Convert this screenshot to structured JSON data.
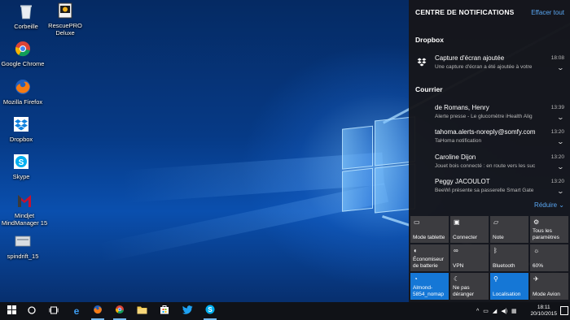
{
  "desktop": {
    "icons": [
      {
        "label": "Corbeille",
        "icon": "recycle-bin-icon"
      },
      {
        "label": "RescuePRO Deluxe",
        "icon": "rescuepro-icon"
      },
      {
        "label": "Google Chrome",
        "icon": "chrome-icon"
      },
      {
        "label": "Mozilla Firefox",
        "icon": "firefox-icon"
      },
      {
        "label": "Dropbox",
        "icon": "dropbox-icon"
      },
      {
        "label": "Skype",
        "icon": "skype-icon"
      },
      {
        "label": "Mindjet MindManager 15",
        "icon": "mindmanager-icon"
      },
      {
        "label": "spindrift_15",
        "icon": "file-icon"
      }
    ]
  },
  "action_center": {
    "title": "CENTRE DE NOTIFICATIONS",
    "clear_all": "Effacer tout",
    "groups": [
      {
        "name": "Dropbox",
        "notifications": [
          {
            "title": "Capture d'écran ajoutée",
            "body": "Une capture d'écran a été ajoutée à votre",
            "time": "18:08"
          }
        ]
      },
      {
        "name": "Courrier",
        "notifications": [
          {
            "title": "de Romans, Henry",
            "body": "Alerte presse - Le glucomètre iHealth Alig",
            "time": "13:39"
          },
          {
            "title": "tahoma.alerts-noreply@somfy.com",
            "body": "TaHoma notification",
            "time": "13:20"
          },
          {
            "title": "Caroline Dijon",
            "body": "Jouet bois connecté : en route vers les suc",
            "time": "13:20"
          },
          {
            "title": "Peggy JACOULOT",
            "body": "BeeWi présente sa passerelle Smart Gate",
            "time": "13:20"
          }
        ]
      }
    ],
    "collapse": "Réduire",
    "quick_actions": [
      {
        "label": "Mode tablette",
        "icon": "tablet-mode-icon",
        "on": false
      },
      {
        "label": "Connecter",
        "icon": "connect-icon",
        "on": false
      },
      {
        "label": "Note",
        "icon": "note-icon",
        "on": false
      },
      {
        "label": "Tous les paramètres",
        "icon": "settings-icon",
        "on": false
      },
      {
        "label": "Économiseur de batterie",
        "icon": "battery-saver-icon",
        "on": false
      },
      {
        "label": "VPN",
        "icon": "vpn-icon",
        "on": false
      },
      {
        "label": "Bluetooth",
        "icon": "bluetooth-icon",
        "on": false
      },
      {
        "label": "60%",
        "icon": "brightness-icon",
        "on": false
      },
      {
        "label": "Almond-5854_nomap",
        "icon": "wifi-icon",
        "on": true
      },
      {
        "label": "Ne pas déranger",
        "icon": "quiet-hours-icon",
        "on": false
      },
      {
        "label": "Localisation",
        "icon": "location-icon",
        "on": true
      },
      {
        "label": "Mode Avion",
        "icon": "airplane-mode-icon",
        "on": false
      }
    ]
  },
  "taskbar": {
    "clock_time": "18:11",
    "clock_date": "20/10/2015",
    "colors": {
      "accent": "#1577d6",
      "link": "#5aa7f2",
      "taskbar": "#101217"
    }
  }
}
